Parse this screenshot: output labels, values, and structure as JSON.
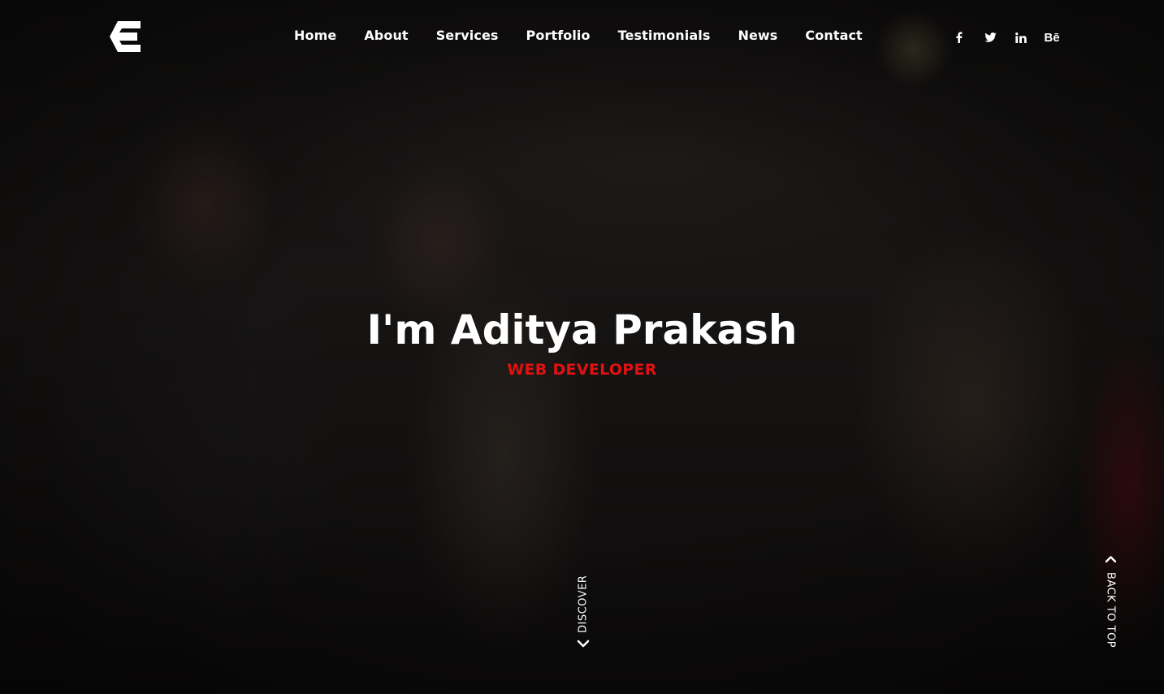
{
  "header": {
    "logo_icon": "stylized-e-logo",
    "nav": [
      {
        "label": "Home"
      },
      {
        "label": "About"
      },
      {
        "label": "Services"
      },
      {
        "label": "Portfolio"
      },
      {
        "label": "Testimonials"
      },
      {
        "label": "News"
      },
      {
        "label": "Contact"
      }
    ],
    "social": [
      {
        "icon": "facebook-icon",
        "glyph": "f"
      },
      {
        "icon": "twitter-icon",
        "glyph": "t"
      },
      {
        "icon": "linkedin-icon",
        "glyph": "in"
      },
      {
        "icon": "behance-icon",
        "glyph": "Bē"
      }
    ]
  },
  "hero": {
    "title": "I'm Aditya Prakash",
    "subtitle": "WEB DEVELOPER",
    "subtitle_color": "#e01111"
  },
  "discover": {
    "label": "DISCOVER",
    "icon": "chevron-down-icon"
  },
  "back_to_top": {
    "label": "BACK TO TOP",
    "icon": "chevron-up-icon"
  }
}
